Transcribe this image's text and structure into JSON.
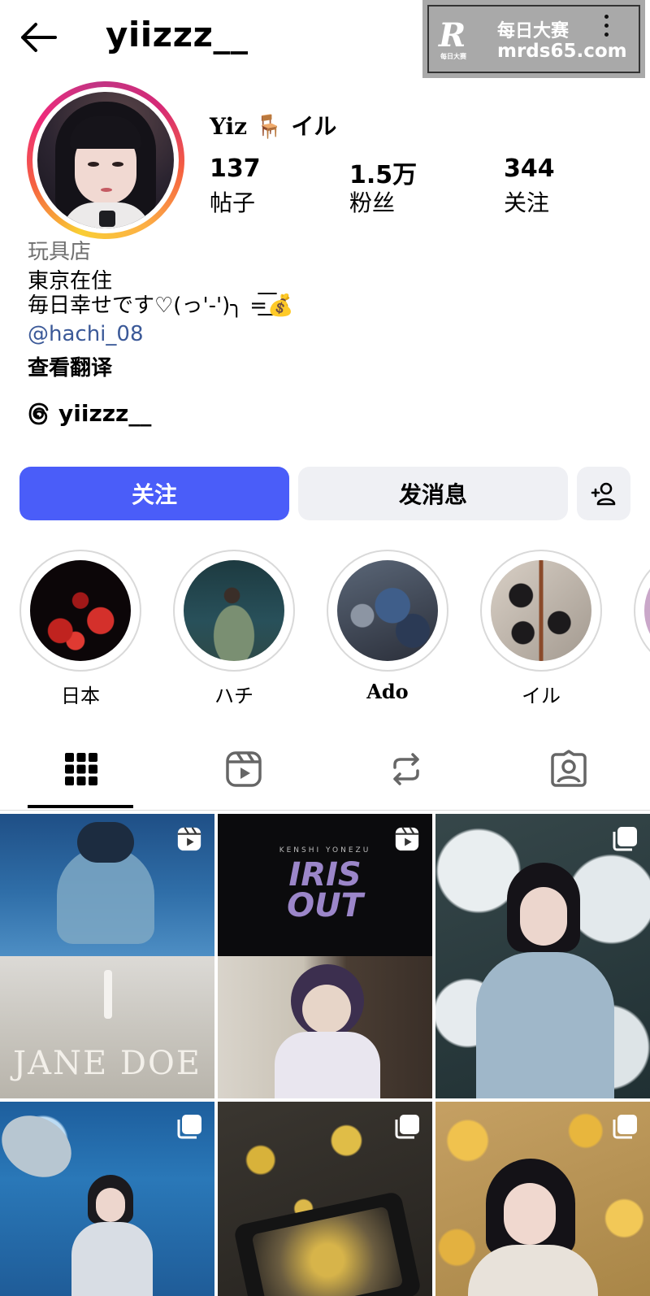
{
  "header": {
    "username": "yiizzz__",
    "watermark_logo": "R",
    "watermark_logo_small": "每日大赛",
    "watermark_title": "每日大赛",
    "watermark_url": "mrds65.com",
    "icons": {
      "back": "arrow-left-icon",
      "more": "kebab-icon"
    }
  },
  "profile": {
    "display_name": "Yiz 🪑 イル",
    "stats": [
      {
        "value": "137",
        "label": "帖子"
      },
      {
        "value": "1.5万",
        "label": "粉丝"
      },
      {
        "value": "344",
        "label": "关注"
      }
    ],
    "category": "玩具店",
    "bio_line_1": "東京在住",
    "bio_line_2": "毎日幸せです♡(っ'-')╮ =͟͟͞͞💰",
    "mention": "@hachi_08",
    "translate_label": "查看翻译",
    "threads_handle": "yiizzz__",
    "story_ring_colors": [
      "#f9ce34",
      "#ee2a7b",
      "#6228d7"
    ]
  },
  "actions": {
    "follow_label": "关注",
    "message_label": "发消息",
    "add_icon": "add-person-icon",
    "follow_color": "#4a5df9"
  },
  "highlights": [
    {
      "label": "日本"
    },
    {
      "label": "ハチ"
    },
    {
      "label": "Ado"
    },
    {
      "label": "イル"
    }
  ],
  "tabs": [
    {
      "icon": "grid-icon",
      "selected": true
    },
    {
      "icon": "reels-icon",
      "selected": false
    },
    {
      "icon": "repost-icon",
      "selected": false
    },
    {
      "icon": "tagged-icon",
      "selected": false
    }
  ],
  "posts": [
    {
      "type": "reel",
      "overlay_text": "JANE DOE"
    },
    {
      "type": "reel",
      "overlay_small": "KENSHI YONEZU",
      "overlay_text": "IRIS OUT"
    },
    {
      "type": "carousel"
    },
    {
      "type": "carousel"
    },
    {
      "type": "carousel"
    },
    {
      "type": "carousel"
    }
  ]
}
